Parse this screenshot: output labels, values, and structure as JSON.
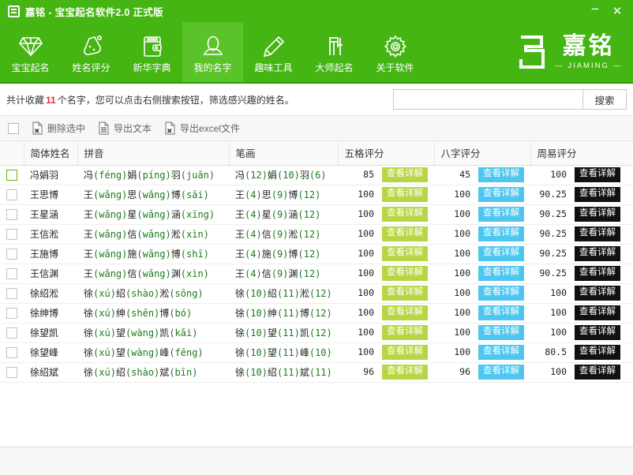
{
  "window": {
    "title": "嘉铭 - 宝宝起名软件2.0 正式版",
    "minimize_label": "−",
    "close_label": "✕"
  },
  "nav": {
    "items": [
      {
        "label": "宝宝起名",
        "icon": "diamond-icon",
        "active": false
      },
      {
        "label": "姓名评分",
        "icon": "flask-icon",
        "active": false
      },
      {
        "label": "新华字典",
        "icon": "wallet-icon",
        "active": false
      },
      {
        "label": "我的名字",
        "icon": "person-icon",
        "active": true
      },
      {
        "label": "趣味工具",
        "icon": "pencil-icon",
        "active": false
      },
      {
        "label": "大师起名",
        "icon": "master-icon",
        "active": false
      },
      {
        "label": "关于软件",
        "icon": "gear-icon",
        "active": false
      }
    ],
    "brand_name": "嘉铭",
    "brand_sub": "— JIAMING —"
  },
  "info": {
    "prefix": "共计收藏",
    "count": "11",
    "suffix": "个名字，您可以点击右侧搜索按钮，筛选感兴趣的姓名。"
  },
  "search": {
    "value": "",
    "placeholder": "",
    "button_label": "搜索"
  },
  "toolbar": {
    "select_all_checked": false,
    "actions": [
      {
        "label": "删除选中",
        "icon": "file-delete-icon"
      },
      {
        "label": "导出文本",
        "icon": "file-text-icon"
      },
      {
        "label": "导出excel文件",
        "icon": "file-excel-icon"
      }
    ]
  },
  "table": {
    "columns": [
      {
        "key": "chk",
        "label": ""
      },
      {
        "key": "name",
        "label": "简体姓名"
      },
      {
        "key": "py",
        "label": "拼音"
      },
      {
        "key": "bh",
        "label": "笔画"
      },
      {
        "key": "wg",
        "label": "五格评分"
      },
      {
        "key": "bz",
        "label": "八字评分"
      },
      {
        "key": "zy",
        "label": "周易评分"
      }
    ],
    "detail_label": "查看详解",
    "rows": [
      {
        "checked": false,
        "highlight": true,
        "name": "冯娟羽",
        "pinyin": [
          [
            "冯",
            "féng"
          ],
          [
            "娟",
            "píng"
          ],
          [
            "羽",
            "juān"
          ]
        ],
        "strokes": [
          [
            "冯",
            "12"
          ],
          [
            "娟",
            "10"
          ],
          [
            "羽",
            "6"
          ]
        ],
        "wuge": "85",
        "bazi": "45",
        "zhouyi": "100"
      },
      {
        "checked": false,
        "highlight": false,
        "name": "王思博",
        "pinyin": [
          [
            "王",
            "wǎng"
          ],
          [
            "思",
            "wǎng"
          ],
          [
            "博",
            "sāi"
          ]
        ],
        "strokes": [
          [
            "王",
            "4"
          ],
          [
            "思",
            "9"
          ],
          [
            "博",
            "12"
          ]
        ],
        "wuge": "100",
        "bazi": "100",
        "zhouyi": "90.25"
      },
      {
        "checked": false,
        "highlight": false,
        "name": "王星涵",
        "pinyin": [
          [
            "王",
            "wǎng"
          ],
          [
            "星",
            "wǎng"
          ],
          [
            "涵",
            "xīng"
          ]
        ],
        "strokes": [
          [
            "王",
            "4"
          ],
          [
            "星",
            "9"
          ],
          [
            "涵",
            "12"
          ]
        ],
        "wuge": "100",
        "bazi": "100",
        "zhouyi": "90.25"
      },
      {
        "checked": false,
        "highlight": false,
        "name": "王信淞",
        "pinyin": [
          [
            "王",
            "wǎng"
          ],
          [
            "信",
            "wǎng"
          ],
          [
            "淞",
            "xìn"
          ]
        ],
        "strokes": [
          [
            "王",
            "4"
          ],
          [
            "信",
            "9"
          ],
          [
            "淞",
            "12"
          ]
        ],
        "wuge": "100",
        "bazi": "100",
        "zhouyi": "90.25"
      },
      {
        "checked": false,
        "highlight": false,
        "name": "王施博",
        "pinyin": [
          [
            "王",
            "wǎng"
          ],
          [
            "施",
            "wǎng"
          ],
          [
            "博",
            "shī"
          ]
        ],
        "strokes": [
          [
            "王",
            "4"
          ],
          [
            "施",
            "9"
          ],
          [
            "博",
            "12"
          ]
        ],
        "wuge": "100",
        "bazi": "100",
        "zhouyi": "90.25"
      },
      {
        "checked": false,
        "highlight": false,
        "name": "王信渊",
        "pinyin": [
          [
            "王",
            "wǎng"
          ],
          [
            "信",
            "wǎng"
          ],
          [
            "渊",
            "xìn"
          ]
        ],
        "strokes": [
          [
            "王",
            "4"
          ],
          [
            "信",
            "9"
          ],
          [
            "渊",
            "12"
          ]
        ],
        "wuge": "100",
        "bazi": "100",
        "zhouyi": "90.25"
      },
      {
        "checked": false,
        "highlight": false,
        "name": "徐绍淞",
        "pinyin": [
          [
            "徐",
            "xú"
          ],
          [
            "绍",
            "shào"
          ],
          [
            "淞",
            "sōng"
          ]
        ],
        "strokes": [
          [
            "徐",
            "10"
          ],
          [
            "绍",
            "11"
          ],
          [
            "淞",
            "12"
          ]
        ],
        "wuge": "100",
        "bazi": "100",
        "zhouyi": "100"
      },
      {
        "checked": false,
        "highlight": false,
        "name": "徐绅博",
        "pinyin": [
          [
            "徐",
            "xú"
          ],
          [
            "绅",
            "shēn"
          ],
          [
            "博",
            "bó"
          ]
        ],
        "strokes": [
          [
            "徐",
            "10"
          ],
          [
            "绅",
            "11"
          ],
          [
            "博",
            "12"
          ]
        ],
        "wuge": "100",
        "bazi": "100",
        "zhouyi": "100"
      },
      {
        "checked": false,
        "highlight": false,
        "name": "徐望凯",
        "pinyin": [
          [
            "徐",
            "xú"
          ],
          [
            "望",
            "wàng"
          ],
          [
            "凯",
            "kǎi"
          ]
        ],
        "strokes": [
          [
            "徐",
            "10"
          ],
          [
            "望",
            "11"
          ],
          [
            "凯",
            "12"
          ]
        ],
        "wuge": "100",
        "bazi": "100",
        "zhouyi": "100"
      },
      {
        "checked": false,
        "highlight": false,
        "name": "徐望峰",
        "pinyin": [
          [
            "徐",
            "xú"
          ],
          [
            "望",
            "wàng"
          ],
          [
            "峰",
            "fēng"
          ]
        ],
        "strokes": [
          [
            "徐",
            "10"
          ],
          [
            "望",
            "11"
          ],
          [
            "峰",
            "10"
          ]
        ],
        "wuge": "100",
        "bazi": "100",
        "zhouyi": "80.5"
      },
      {
        "checked": false,
        "highlight": false,
        "name": "徐绍斌",
        "pinyin": [
          [
            "徐",
            "xú"
          ],
          [
            "绍",
            "shào"
          ],
          [
            "斌",
            "bīn"
          ]
        ],
        "strokes": [
          [
            "徐",
            "10"
          ],
          [
            "绍",
            "11"
          ],
          [
            "斌",
            "11"
          ]
        ],
        "wuge": "96",
        "bazi": "96",
        "zhouyi": "100"
      }
    ]
  },
  "colors": {
    "brand_green": "#45b514",
    "active_green": "#59c329",
    "count_red": "#e8312f",
    "btn_green": "#b8d644",
    "btn_blue": "#4ec6ef",
    "btn_black": "#111111",
    "pinyin_green": "#1e7a1e"
  }
}
